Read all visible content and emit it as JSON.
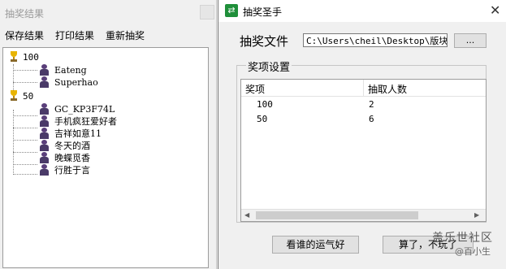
{
  "left_window": {
    "title": "抽奖结果",
    "menu": [
      "保存结果",
      "打印结果",
      "重新抽奖"
    ],
    "tree": [
      {
        "label": "100",
        "children": [
          "Eateng",
          "Superhao"
        ]
      },
      {
        "label": "50",
        "children": [
          "GC_KP3F74L",
          "手机疯狂爱好者",
          "吉祥如意11",
          "冬天的酒",
          "晚蝶觅香",
          "行胜于言"
        ]
      }
    ]
  },
  "right_window": {
    "title": "抽奖圣手",
    "close_glyph": "✕",
    "file_label": "抽奖文件",
    "file_path": "C:\\Users\\cheil\\Desktop\\版块活",
    "browse_label": "...",
    "prize_group_label": "奖项设置",
    "table": {
      "columns": [
        "奖项",
        "抽取人数"
      ],
      "rows": [
        [
          "100",
          "2"
        ],
        [
          "50",
          "6"
        ]
      ]
    },
    "draw_button": "看谁的运气好",
    "quit_button": "算了，不玩了"
  },
  "watermark": {
    "line1": "盖乐世社区",
    "line2": "@百小生"
  },
  "icons": {
    "tree_root": "trophy-icon",
    "tree_child": "user-icon",
    "app": "app-icon"
  }
}
